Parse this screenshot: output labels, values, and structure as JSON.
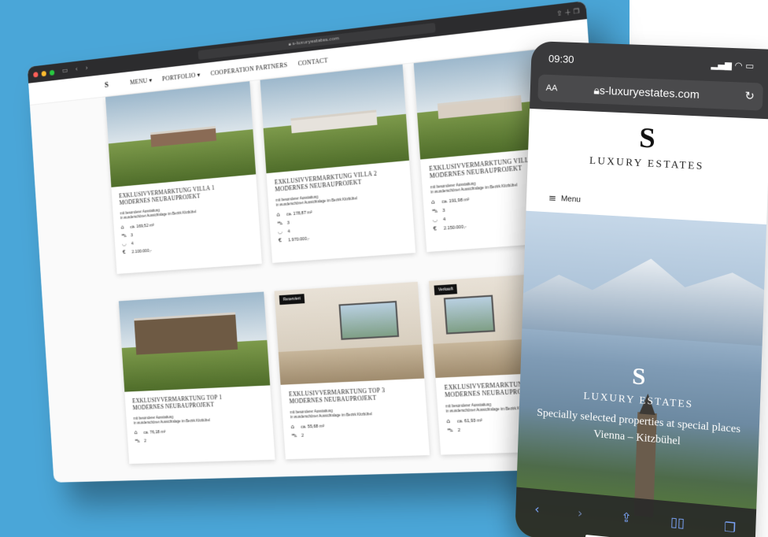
{
  "browser": {
    "address": "s-luxuryestates.com",
    "nav": {
      "logo": "S",
      "items": [
        "MENU",
        "PORTFOLIO",
        "COOPERATION PARTNERS",
        "CONTACT"
      ]
    }
  },
  "listings": [
    {
      "title_1": "EXKLUSIVVERMARKTUNG VILLA 1",
      "title_2": "MODERNES NEUBAUPROJEKT",
      "desc_1": "mit besonderer Ausstattung",
      "desc_2": "in wunderschöner Aussichtslage im Bezirk Kitzbühel",
      "area": "ca. 169,52 m²",
      "cars": "3",
      "baths": "4",
      "price": "2.100.000,-",
      "badge": ""
    },
    {
      "title_1": "EXKLUSIVVERMARKTUNG VILLA 2",
      "title_2": "MODERNES NEUBAUPROJEKT",
      "desc_1": "mit besonderer Ausstattung",
      "desc_2": "in wunderschöner Aussichtslage im Bezirk Kitzbühel",
      "area": "ca. 178,87 m²",
      "cars": "3",
      "baths": "4",
      "price": "1.970.000,-",
      "badge": ""
    },
    {
      "title_1": "EXKLUSIVVERMARKTUNG VILLA 3",
      "title_2": "MODERNES NEUBAUPROJEKT",
      "desc_1": "mit besonderer Ausstattung",
      "desc_2": "in wunderschöner Aussichtslage im Bezirk Kitzbühel",
      "area": "ca. 191,98 m²",
      "cars": "3",
      "baths": "4",
      "price": "2.150.000,-",
      "badge": ""
    },
    {
      "title_1": "EXKLUSIVVERMARKTUNG TOP 1",
      "title_2": "MODERNES NEUBAUPROJEKT",
      "desc_1": "mit besonderer Ausstattung",
      "desc_2": "in wunderschöner Aussichtslage im Bezirk Kitzbühel",
      "area": "ca. 76,18 m²",
      "cars": "2",
      "badge": ""
    },
    {
      "title_1": "EXKLUSIVVERMARKTUNG TOP 3",
      "title_2": "MODERNES NEUBAUPROJEKT",
      "desc_1": "mit besonderer Ausstattung",
      "desc_2": "in wunderschöner Aussichtslage im Bezirk Kitzbühel",
      "area": "ca. 55,68 m²",
      "cars": "2",
      "badge": "Reserviert"
    },
    {
      "title_1": "EXKLUSIVVERMARKTUNG TOP 5",
      "title_2": "MODERNES NEUBAUPROJEKT",
      "desc_1": "mit besonderer Ausstattung",
      "desc_2": "in wunderschöner Aussichtslage im Bezirk Kitzbühel",
      "area": "ca. 61,93 m²",
      "cars": "2",
      "badge": "Verkauft"
    }
  ],
  "phone": {
    "time": "09:30",
    "aa": "AA",
    "address": "s-luxuryestates.com",
    "brand_s": "S",
    "brand_name": "LUXURY ESTATES",
    "menu_label": "Menu",
    "hero_s": "S",
    "hero_brand": "LUXURY ESTATES",
    "hero_tagline": "Specially selected properties at special places",
    "hero_location": "Vienna – Kitzbühel"
  },
  "icons": {
    "area": "house-area-icon",
    "cars": "car-icon",
    "baths": "bathtub-icon",
    "price": "euro-icon"
  }
}
